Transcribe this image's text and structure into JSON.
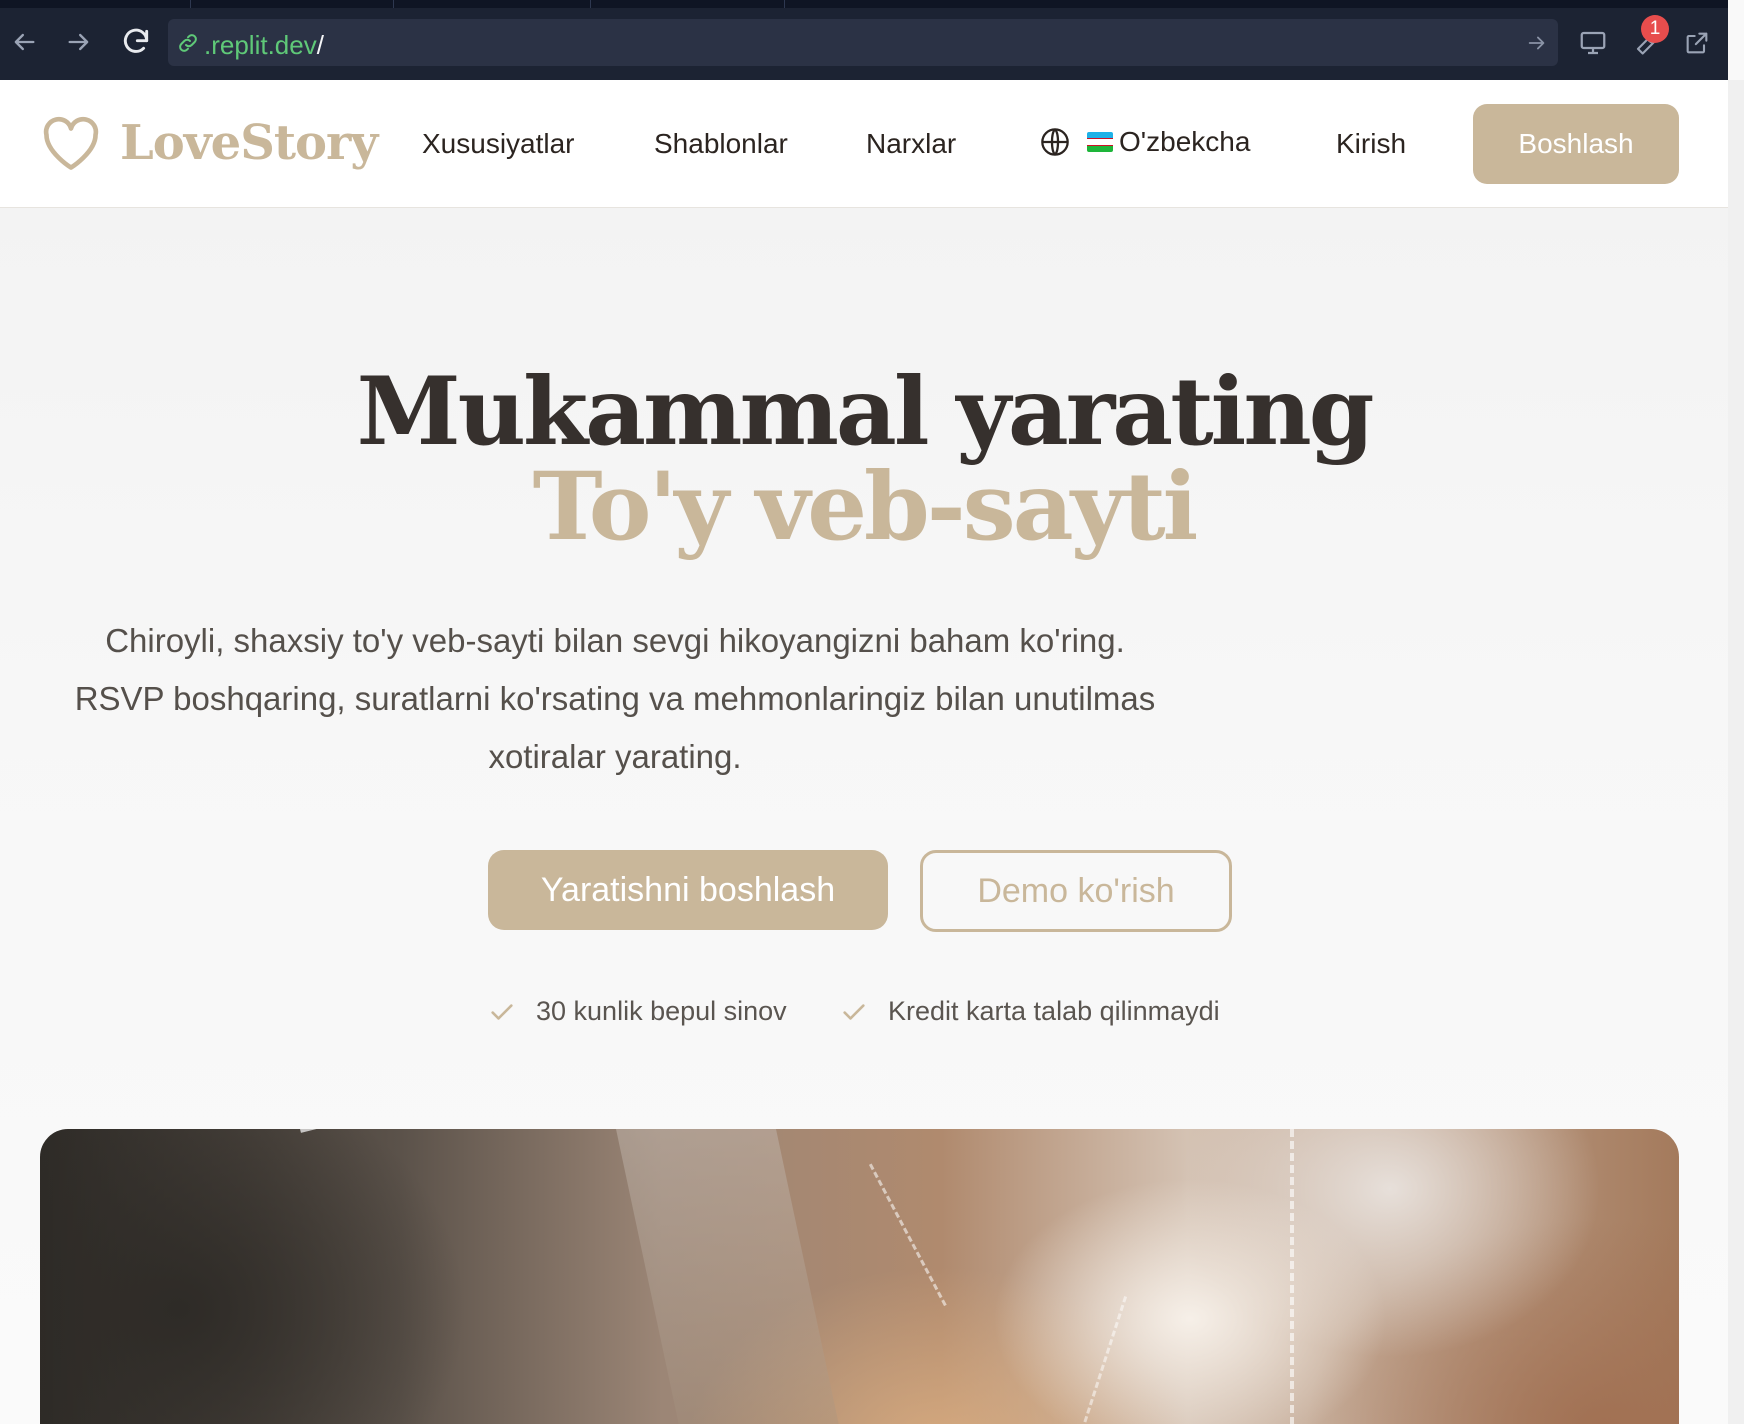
{
  "browser": {
    "url_host": ".replit.dev",
    "url_path": "/",
    "devtools_badge": "1"
  },
  "header": {
    "logo_text": "LoveStory",
    "nav": {
      "features": "Xususiyatlar",
      "templates": "Shablonlar",
      "pricing": "Narxlar",
      "language": "O'zbekcha",
      "login": "Kirish"
    },
    "cta": "Boshlash"
  },
  "hero": {
    "title": "Mukammal yarating",
    "title_accent": "To'y veb-sayti",
    "subtitle_line1": "Chiroyli, shaxsiy to'y veb-sayti bilan sevgi hikoyangizni baham ko'ring.",
    "subtitle_line2": "RSVP boshqaring, suratlarni ko'rsating va mehmonlaringiz bilan unutilmas",
    "subtitle_line3": "xotiralar yarating.",
    "primary_button": "Yaratishni boshlash",
    "secondary_button": "Demo ko'rish",
    "perks": [
      "30 kunlik bepul sinov",
      "Kredit karta talab qilinmaydi"
    ]
  },
  "colors": {
    "accent": "#c9b79a",
    "heading": "#36302d",
    "chrome_bg": "#1c2333",
    "url_green": "#5fc978",
    "badge_red": "#e74d4d"
  },
  "icons": [
    "back-arrow-icon",
    "forward-arrow-icon",
    "reload-icon",
    "link-icon",
    "go-arrow-icon",
    "devices-icon",
    "wrench-icon",
    "open-external-icon",
    "heart-icon",
    "globe-icon",
    "check-icon"
  ]
}
